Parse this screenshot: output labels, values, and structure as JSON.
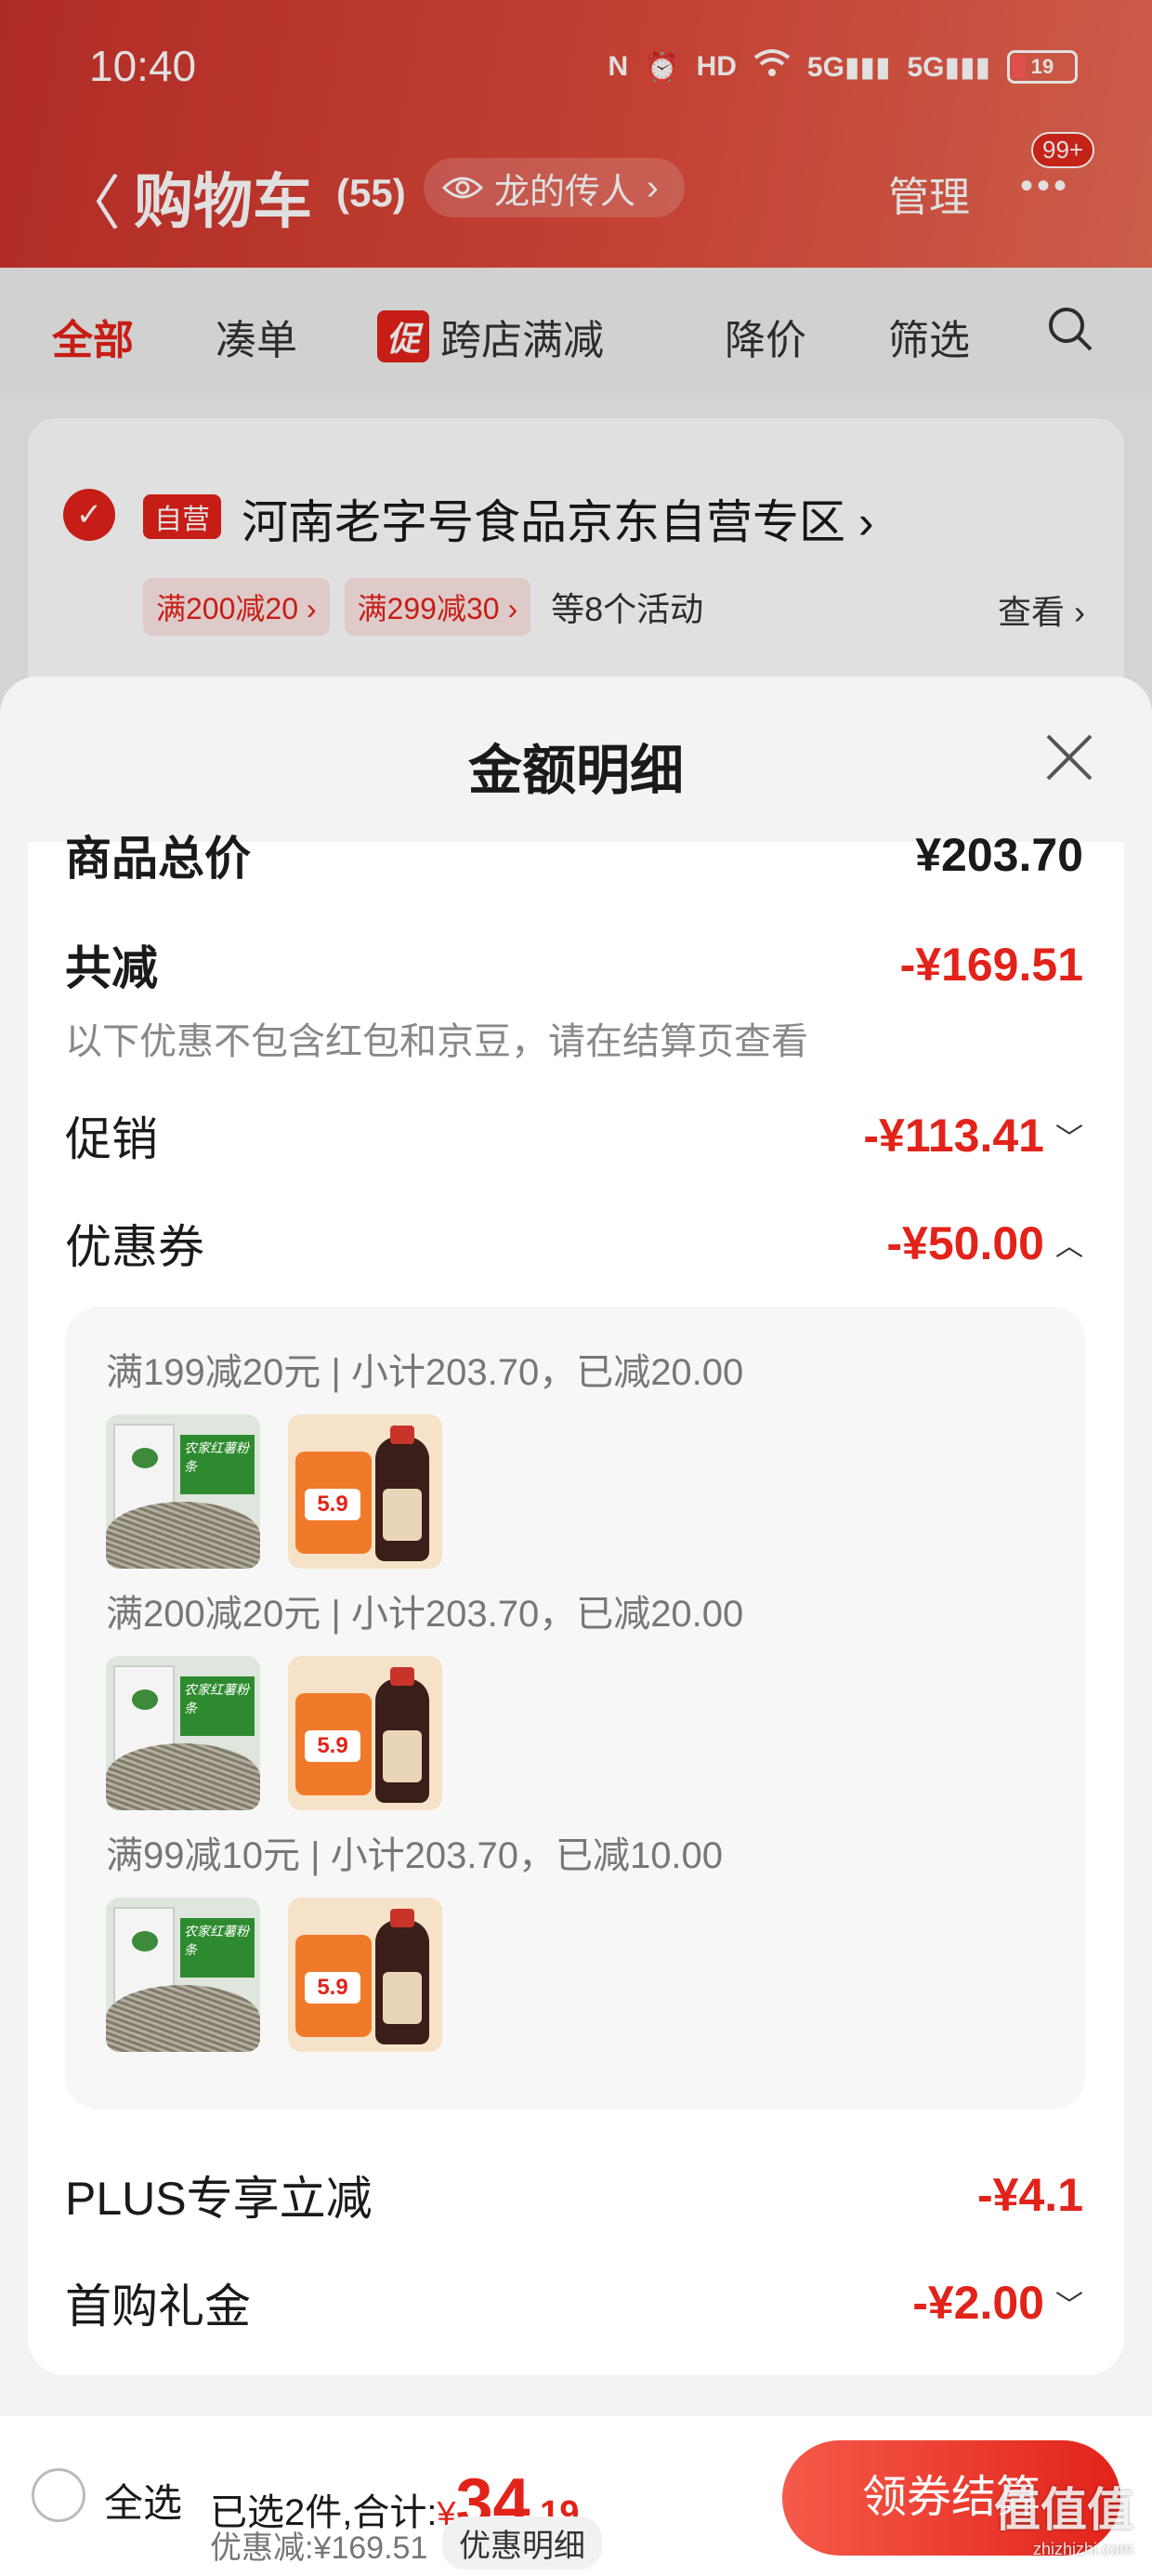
{
  "status_bar": {
    "time": "10:40",
    "icons": [
      "nfc-icon",
      "alarm-icon",
      "hd-icon",
      "wifi-icon",
      "signal-5g-icon",
      "signal-5g-icon"
    ],
    "battery": "19"
  },
  "nav": {
    "back": "〈",
    "title": "购物车",
    "count": "(55)",
    "account": "龙的传人",
    "manage": "管理",
    "more": "•••",
    "badge": "99+"
  },
  "tabs": {
    "all": "全部",
    "combine": "凑单",
    "promo_tag": "促",
    "cross_store": "跨店满减",
    "price_drop": "降价",
    "filter": "筛选"
  },
  "store": {
    "self_tag": "自营",
    "name": "河南老字号食品京东自营专区",
    "promos": [
      "满200减20",
      "满299减30"
    ],
    "more": "等8个活动",
    "view": "查看"
  },
  "sheet": {
    "title": "金额明细",
    "rows": {
      "total_label": "商品总价",
      "total_value": "¥203.70",
      "reduced_label": "共减",
      "reduced_value": "-¥169.51",
      "note": "以下优惠不包含红包和京豆，请在结算页查看",
      "promo_label": "促销",
      "promo_value": "-¥113.41",
      "coupon_label": "优惠券",
      "coupon_value": "-¥50.00",
      "plus_label": "PLUS专享立减",
      "plus_value": "-¥4.1",
      "gift_label": "首购礼金",
      "gift_value": "-¥2.00"
    },
    "coupons": [
      {
        "text": "满199减20元 | 小计203.70，已减20.00"
      },
      {
        "text": "满200减20元 | 小计203.70，已减20.00"
      },
      {
        "text": "满99减10元 | 小计203.70，已减10.00"
      }
    ],
    "thumb_price": "5.9"
  },
  "bottom": {
    "select_all": "全选",
    "selected": "已选2件,合计:",
    "currency": "¥",
    "total_int": "34",
    "total_dec": ".19",
    "discount": "优惠减:¥169.51",
    "detail": "优惠明细",
    "checkout": "领券结算"
  },
  "watermark": {
    "text": "值值值",
    "sub": "zhizhizhi.com"
  },
  "colors": {
    "brand_red": "#e2231a",
    "header_start": "#c9322c",
    "header_end": "#e86a54"
  }
}
